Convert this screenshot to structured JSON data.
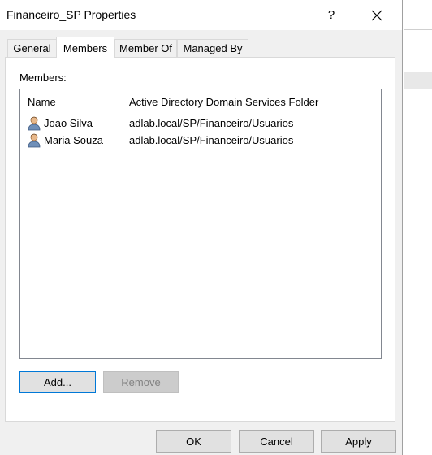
{
  "window": {
    "title": "Financeiro_SP Properties",
    "help_glyph": "?"
  },
  "tabs": [
    {
      "label": "General"
    },
    {
      "label": "Members",
      "active": true
    },
    {
      "label": "Member Of"
    },
    {
      "label": "Managed By"
    }
  ],
  "members": {
    "label": "Members:",
    "columns": [
      "Name",
      "Active Directory Domain Services Folder"
    ],
    "rows": [
      {
        "name": "Joao Silva",
        "folder": "adlab.local/SP/Financeiro/Usuarios",
        "icon": "user-icon"
      },
      {
        "name": "Maria Souza",
        "folder": "adlab.local/SP/Financeiro/Usuarios",
        "icon": "user-icon"
      }
    ]
  },
  "buttons": {
    "add": "Add...",
    "remove": "Remove",
    "ok": "OK",
    "cancel": "Cancel",
    "apply": "Apply"
  },
  "colors": {
    "accent": "#0078d7",
    "dialog_bg": "#f0f0f0",
    "disabled_bg": "#cccccc"
  }
}
